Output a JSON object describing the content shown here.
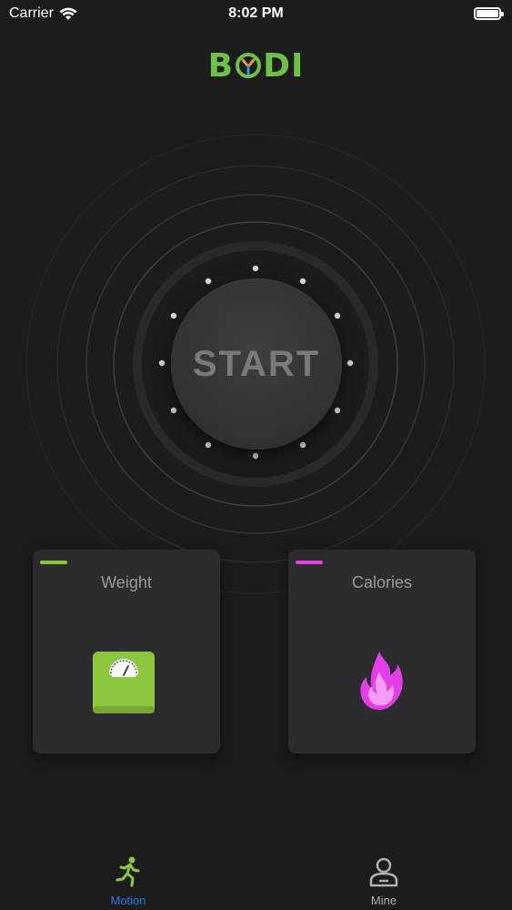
{
  "status_bar": {
    "carrier": "Carrier",
    "time": "8:02 PM"
  },
  "logo": {
    "text_b": "B",
    "text_di": "DI"
  },
  "start_button": {
    "label": "START"
  },
  "cards": [
    {
      "title": "Weight",
      "accent_color": "#8dc63f",
      "icon": "scale-icon"
    },
    {
      "title": "Calories",
      "accent_color": "#e040e0",
      "icon": "flame-icon"
    }
  ],
  "tab_bar": {
    "tabs": [
      {
        "label": "Motion",
        "icon": "running-person-icon",
        "active": true,
        "color": "#1e7be8"
      },
      {
        "label": "Mine",
        "icon": "person-icon",
        "active": false,
        "color": "#b0b0b2"
      }
    ]
  },
  "colors": {
    "background": "#1c1c1d",
    "brand_green": "#6fc04b"
  }
}
